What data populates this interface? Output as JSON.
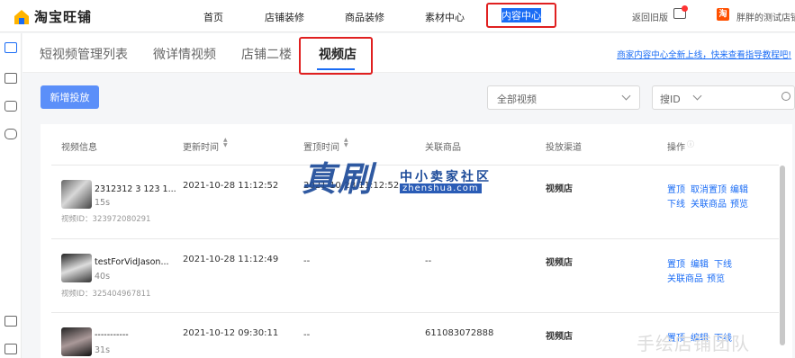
{
  "app": {
    "logo_text": "淘宝旺铺"
  },
  "nav": [
    {
      "label": "首页"
    },
    {
      "label": "店铺装修"
    },
    {
      "label": "商品装修"
    },
    {
      "label": "素材中心"
    },
    {
      "label": "内容中心"
    }
  ],
  "header_right": {
    "back_label": "返回旧版",
    "shop_icon": "淘",
    "shop_name": "胖胖的测试店铺"
  },
  "tabs": [
    {
      "label": "短视频管理列表"
    },
    {
      "label": "微详情视频"
    },
    {
      "label": "店铺二楼"
    },
    {
      "label": "视频店"
    }
  ],
  "guide_link": "商家内容中心全新上线，快来查看指导教程吧!",
  "toolbar": {
    "new_button": "新增投放",
    "filter_selected": "全部视频",
    "search_type": "搜ID",
    "search_placeholder": ""
  },
  "table": {
    "headers": [
      "视频信息",
      "更新时间",
      "置顶时间",
      "关联商品",
      "投放渠道",
      "操作"
    ],
    "rows": [
      {
        "title": "2312312 3 123 1...",
        "duration": "15s",
        "video_id": "视频ID：323972080291",
        "update_time": "2021-10-28 11:12:52",
        "pin_time": "2021-10-28 11:12:52",
        "product": "",
        "channel": "视频店",
        "actions_line1": [
          "置顶",
          "取消置顶",
          "编辑"
        ],
        "actions_line2": [
          "下线",
          "关联商品",
          "预览"
        ]
      },
      {
        "title": "testForVidJason...",
        "duration": "40s",
        "video_id": "视频ID：325404967811",
        "update_time": "2021-10-28 11:12:49",
        "pin_time": "--",
        "product": "--",
        "channel": "视频店",
        "actions_line1": [
          "置顶",
          "编辑",
          "下线"
        ],
        "actions_line2": [
          "关联商品",
          "预览"
        ]
      },
      {
        "title": "-----------",
        "duration": "31s",
        "video_id": "",
        "update_time": "2021-10-12 09:30:11",
        "pin_time": "--",
        "product": "611083072888",
        "channel": "视频店",
        "actions_line1": [
          "置顶",
          "编辑",
          "下线"
        ],
        "actions_line2": []
      }
    ]
  },
  "watermark": {
    "main": "真刷",
    "sub": "中小卖家社区",
    "url": "zhenshua.com",
    "corner": "手绘店铺团队"
  }
}
